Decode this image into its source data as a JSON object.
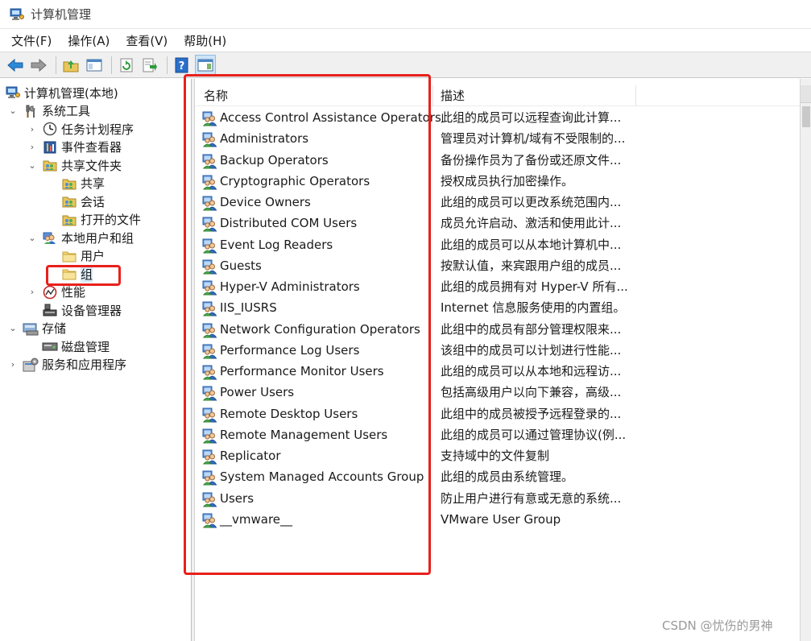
{
  "window": {
    "title": "计算机管理",
    "accent": "#0078d7",
    "highlight_color": "#e8201c"
  },
  "menu": [
    "文件(F)",
    "操作(A)",
    "查看(V)",
    "帮助(H)"
  ],
  "toolbar": {
    "buttons": [
      "back-arrow-icon",
      "forward-arrow-icon",
      "up-folder-icon",
      "show-hide-tree-icon",
      "refresh-icon",
      "export-list-icon",
      "help-icon",
      "action-pane-icon"
    ]
  },
  "tree": {
    "items": [
      {
        "label": "计算机管理(本地)",
        "level": 0,
        "expander": "",
        "icon": "computer-management-icon"
      },
      {
        "label": "系统工具",
        "level": 1,
        "expander": "expanded",
        "icon": "tools-icon"
      },
      {
        "label": "任务计划程序",
        "level": 2,
        "expander": "collapsed",
        "icon": "clock-icon"
      },
      {
        "label": "事件查看器",
        "level": 2,
        "expander": "collapsed",
        "icon": "event-viewer-icon"
      },
      {
        "label": "共享文件夹",
        "level": 2,
        "expander": "expanded",
        "icon": "shared-folder-icon"
      },
      {
        "label": "共享",
        "level": 3,
        "expander": "",
        "icon": "shared-folder-icon"
      },
      {
        "label": "会话",
        "level": 3,
        "expander": "",
        "icon": "shared-folder-icon"
      },
      {
        "label": "打开的文件",
        "level": 3,
        "expander": "",
        "icon": "shared-folder-icon"
      },
      {
        "label": "本地用户和组",
        "level": 2,
        "expander": "expanded",
        "icon": "users-group-icon"
      },
      {
        "label": "用户",
        "level": 3,
        "expander": "",
        "icon": "folder-icon"
      },
      {
        "label": "组",
        "level": 3,
        "expander": "",
        "icon": "folder-icon",
        "selected": true
      },
      {
        "label": "性能",
        "level": 2,
        "expander": "collapsed",
        "icon": "performance-icon"
      },
      {
        "label": "设备管理器",
        "level": 2,
        "expander": "",
        "icon": "device-manager-icon"
      },
      {
        "label": "存储",
        "level": 1,
        "expander": "expanded",
        "icon": "storage-icon"
      },
      {
        "label": "磁盘管理",
        "level": 2,
        "expander": "",
        "icon": "disk-icon"
      },
      {
        "label": "服务和应用程序",
        "level": 1,
        "expander": "collapsed",
        "icon": "services-icon"
      }
    ]
  },
  "list": {
    "columns": [
      "名称",
      "描述"
    ],
    "rows": [
      {
        "name": "Access Control Assistance Operators",
        "desc": "此组的成员可以远程查询此计算..."
      },
      {
        "name": "Administrators",
        "desc": "管理员对计算机/域有不受限制的..."
      },
      {
        "name": "Backup Operators",
        "desc": "备份操作员为了备份或还原文件..."
      },
      {
        "name": "Cryptographic Operators",
        "desc": "授权成员执行加密操作。"
      },
      {
        "name": "Device Owners",
        "desc": "此组的成员可以更改系统范围内..."
      },
      {
        "name": "Distributed COM Users",
        "desc": "成员允许启动、激活和使用此计..."
      },
      {
        "name": "Event Log Readers",
        "desc": "此组的成员可以从本地计算机中..."
      },
      {
        "name": "Guests",
        "desc": "按默认值，来宾跟用户组的成员..."
      },
      {
        "name": "Hyper-V Administrators",
        "desc": "此组的成员拥有对 Hyper-V 所有..."
      },
      {
        "name": "IIS_IUSRS",
        "desc": "Internet 信息服务使用的内置组。"
      },
      {
        "name": "Network Configuration Operators",
        "desc": "此组中的成员有部分管理权限来..."
      },
      {
        "name": "Performance Log Users",
        "desc": "该组中的成员可以计划进行性能..."
      },
      {
        "name": "Performance Monitor Users",
        "desc": "此组的成员可以从本地和远程访..."
      },
      {
        "name": "Power Users",
        "desc": "包括高级用户以向下兼容，高级..."
      },
      {
        "name": "Remote Desktop Users",
        "desc": "此组中的成员被授予远程登录的..."
      },
      {
        "name": "Remote Management Users",
        "desc": "此组的成员可以通过管理协议(例..."
      },
      {
        "name": "Replicator",
        "desc": "支持域中的文件复制"
      },
      {
        "name": "System Managed Accounts Group",
        "desc": "此组的成员由系统管理。"
      },
      {
        "name": "Users",
        "desc": "防止用户进行有意或无意的系统..."
      },
      {
        "name": "__vmware__",
        "desc": "VMware User Group"
      }
    ]
  },
  "watermark": "CSDN @忧伤的男神"
}
